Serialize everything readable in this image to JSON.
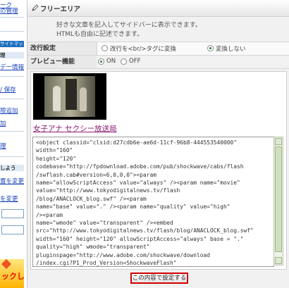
{
  "sidebar": {
    "items": [
      {
        "text": "ーク"
      },
      {
        "text": "の管理"
      },
      {
        "text": "サイトマップ"
      },
      {
        "text": "理"
      },
      {
        "text": "デー情報"
      },
      {
        "text": "/ 保存"
      },
      {
        "text": "限追加"
      },
      {
        "text": "加"
      },
      {
        "text": "理"
      },
      {
        "text": "しよう"
      },
      {
        "text": "置を変更"
      },
      {
        "text": "を変更"
      },
      {
        "text": "ックし"
      }
    ]
  },
  "section": {
    "title": "フリーエリア",
    "desc1": "好きな文章を記入してサイドバーに表示できます。",
    "desc2": "HTMLも自由に記述できます。"
  },
  "settings": {
    "linebreak": {
      "label": "改行設定",
      "options": [
        "改行を<br/>タグに変換",
        "変換しない"
      ],
      "selected": "変換しない"
    },
    "preview": {
      "label": "プレビュー機能",
      "options": [
        "ON",
        "OFF"
      ],
      "selected": "ON"
    }
  },
  "preview": {
    "video_title": "女子アナ セクシー放送局"
  },
  "code_lines": [
    "<object classid=\"clsid:d27cdb6e-ae6d-11cf-96b8-444553540000\"",
    "width=\"160\"",
    "height=\"120\"",
    "codebase=\"http://fpdownload.adobe.com/pub/shockwave/cabs/flash",
    "/swflash.cab#version=6,0,0,0\"><param",
    "name=\"allowScriptAccess\" value=\"always\" /><param name=\"movie\"",
    "value=\"http://www.tokyodigitalnews.tv/flash",
    "/blog/ANACLOCK_blog.swf\" /><param",
    "name=\"base\" value=\".\" /><param name=\"quality\" value=\"high\"",
    "/><param",
    "name=\"wmode\" value=\"transparent\" /><embed",
    "src=\"http://www.tokyodigitalnews.tv/flash/blog/ANACLOCK_blog.swf\"",
    "width=\"160\" height=\"120\" allowScriptAccess=\"always\" base = \".\"",
    "quality=\"high\" wmode=\"transparent\"",
    "pluginspage=\"http://www.adobe.com/shockwave/download",
    "/index.cgi?P1_Prod_Version=ShockwaveFlash\""
  ],
  "submit_label": "この内容で設定する",
  "colors": {
    "accent_border": "#d10000",
    "sidebar_band": "#1e6fbf",
    "link": "#1a44b8",
    "video_link": "#8a1a78"
  }
}
